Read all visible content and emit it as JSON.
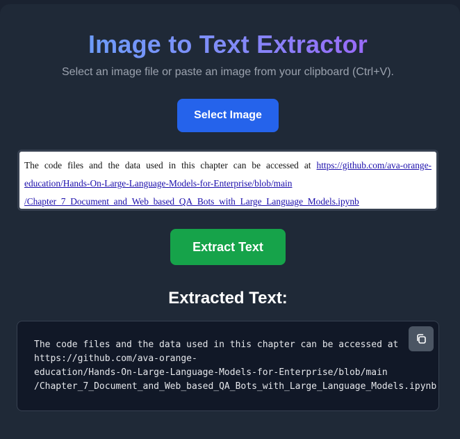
{
  "header": {
    "title": "Image to Text Extractor",
    "subtitle": "Select an image file or paste an image from your clipboard (Ctrl+V)."
  },
  "actions": {
    "select_label": "Select Image",
    "extract_label": "Extract Text"
  },
  "preview": {
    "text_before_link": "The code files and the data used in this chapter can be accessed at ",
    "link_text": "https://github.com/ava-orange-education/Hands-On-Large-Language-Models-for-Enterprise/blob/main /Chapter_7_Document_and_Web_based_QA_Bots_with_Large_Language_Models.ipynb"
  },
  "result": {
    "heading": "Extracted Text:",
    "text": "The code files and the data used in this chapter can be accessed at\nhttps://github.com/ava-orange-\neducation/Hands-On-Large-Language-Models-for-Enterprise/blob/main\n/Chapter_7_Document_and_Web_based_QA_Bots_with_Large_Language_Models.ipynb",
    "copy_icon": "copy-icon"
  },
  "colors": {
    "background": "#1f2937",
    "title_gradient_start": "#60a5fa",
    "title_gradient_end": "#a855f7",
    "select_button": "#2563eb",
    "extract_button": "#16a34a",
    "result_background": "#111827",
    "copy_button": "#4b5563"
  }
}
